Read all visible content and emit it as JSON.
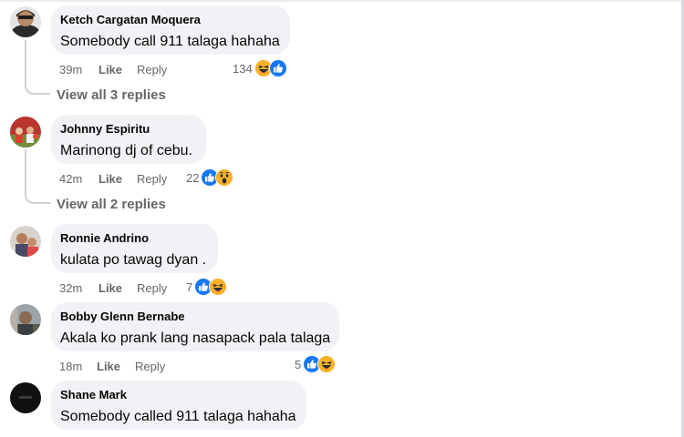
{
  "comments": [
    {
      "author": "Ketch Cargatan Moquera",
      "text": "Somebody call 911 talaga hahaha",
      "time": "39m",
      "like_label": "Like",
      "reply_label": "Reply",
      "reaction_count": "134",
      "reaction_icons": [
        "haha-icon",
        "like-icon"
      ],
      "view_replies": "View all 3 replies"
    },
    {
      "author": "Johnny Espiritu",
      "text": "Marinong dj of cebu.",
      "time": "42m",
      "like_label": "Like",
      "reply_label": "Reply",
      "reaction_count": "22",
      "reaction_icons": [
        "like-icon",
        "wow-icon"
      ],
      "view_replies": "View all 2 replies"
    },
    {
      "author": "Ronnie Andrino",
      "text": "kulata po tawag dyan .",
      "time": "32m",
      "like_label": "Like",
      "reply_label": "Reply",
      "reaction_count": "7",
      "reaction_icons": [
        "like-icon",
        "haha-icon"
      ]
    },
    {
      "author": "Bobby Glenn Bernabe",
      "text": "Akala ko prank lang nasapack pala talaga",
      "time": "18m",
      "like_label": "Like",
      "reply_label": "Reply",
      "reaction_count": "5",
      "reaction_icons": [
        "like-icon",
        "haha-icon"
      ]
    },
    {
      "author": "Shane Mark",
      "text": "Somebody called 911 talaga hahaha"
    }
  ],
  "colors": {
    "bubble": "#f0f2f5",
    "meta_text": "#65676b",
    "like_blue": "#1877f2",
    "reaction_yellow": "#f7b125"
  }
}
